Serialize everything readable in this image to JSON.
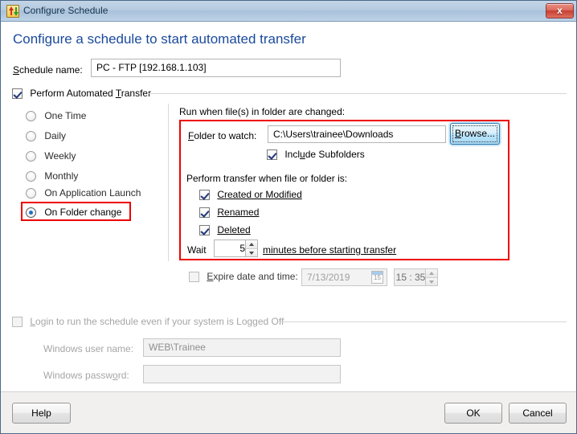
{
  "window": {
    "title": "Configure Schedule",
    "app_icon": "transfer-arrows-icon",
    "close_label": "x",
    "accent_color": "#1a4a9c",
    "highlight_color": "#ee0000"
  },
  "header": {
    "title": "Configure a schedule to start automated transfer"
  },
  "schedule_name": {
    "label_pre": "S",
    "label_post": "chedule name:",
    "value": "PC - FTP [192.168.1.103]"
  },
  "perform_group": {
    "checked": true,
    "label_a": "Perform Automated ",
    "label_mn": "T",
    "label_b": "ransfer"
  },
  "schedule_types": {
    "items": [
      {
        "label": "One Time",
        "selected": false
      },
      {
        "label": "Daily",
        "selected": false
      },
      {
        "label": "Weekly",
        "selected": false
      },
      {
        "label": "Monthly",
        "selected": false
      },
      {
        "label": "On Application Launch",
        "selected": false
      },
      {
        "label": "On Folder change",
        "selected": true
      }
    ],
    "selected_value": "On Folder change"
  },
  "folder_panel": {
    "heading": "Run when file(s) in folder are changed:",
    "folder_label_mn": "F",
    "folder_label_rest": "older to watch:",
    "folder_value": "C:\\Users\\trainee\\Downloads",
    "browse_label_a": "B",
    "browse_label_b": "rowse...",
    "include_subfolders": {
      "checked": true,
      "label_a": "Incl",
      "label_mn": "u",
      "label_b": "de Subfolders"
    },
    "events_heading": "Perform transfer when file or folder is:",
    "events": [
      {
        "mn": "C",
        "rest": "reated or Modified",
        "checked": true
      },
      {
        "mn": "R",
        "rest": "enamed",
        "checked": true
      },
      {
        "mn": "D",
        "rest": "eleted",
        "checked": true
      }
    ],
    "wait": {
      "prefix": "Wait",
      "value": "5",
      "suffix_mn": "m",
      "suffix_rest": "inutes before starting transfer"
    }
  },
  "expire": {
    "checked": false,
    "label_mn": "E",
    "label_rest": "xpire date and time:",
    "date_value": "7/13/2019",
    "calendar_icon_day": "15",
    "time_value": "15 : 35"
  },
  "login_section": {
    "checkbox_checked": false,
    "label_mn": "L",
    "label_rest": "ogin to run the schedule even if your system is Logged Off",
    "user_label_a": "Windows user name:",
    "user_value": "WEB\\Trainee",
    "pass_label_a": "Windows passw",
    "pass_label_mn": "o",
    "pass_label_b": "rd:",
    "pass_value": ""
  },
  "footer": {
    "help_label": "Help",
    "ok_label": "OK",
    "cancel_label": "Cancel"
  }
}
